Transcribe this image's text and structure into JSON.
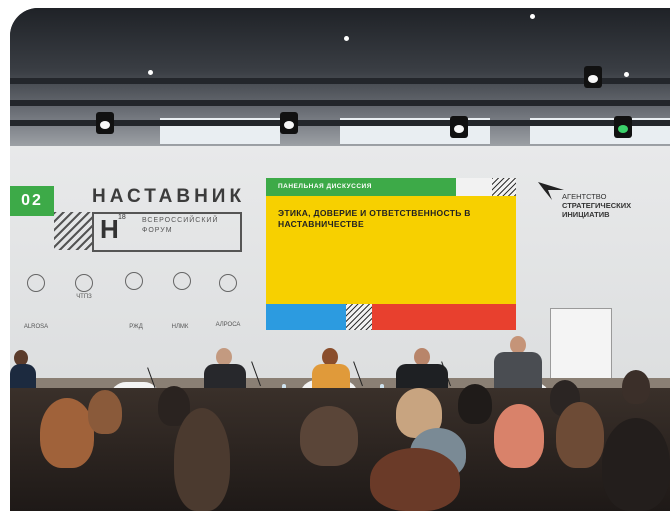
{
  "backdrop": {
    "year_badge": "02",
    "logo_title": "НАСТАВНИК",
    "logo_letter": "Н",
    "logo_superscript": "18",
    "logo_subtitle": "ВСЕРОССИЙСКИЙ ФОРУМ",
    "partner_small": [
      "ЧТПЗ",
      "ALROSA",
      "РЖД",
      "НЛМК",
      "АЛРОСА"
    ]
  },
  "screen": {
    "bar_label": "ПАНЕЛЬНАЯ ДИСКУССИЯ",
    "heading": "ЭТИКА, ДОВЕРИЕ И ОТВЕТСТВЕННОСТЬ В НАСТАВНИЧЕСТВЕ"
  },
  "asi_logo": {
    "line1": "АГЕНТСТВО",
    "line2": "СТРАТЕГИЧЕСКИХ",
    "line3": "ИНИЦИАТИВ"
  },
  "colors": {
    "green": "#3daa48",
    "yellow": "#f7d000",
    "blue": "#2c9be0",
    "red": "#e8402e"
  }
}
